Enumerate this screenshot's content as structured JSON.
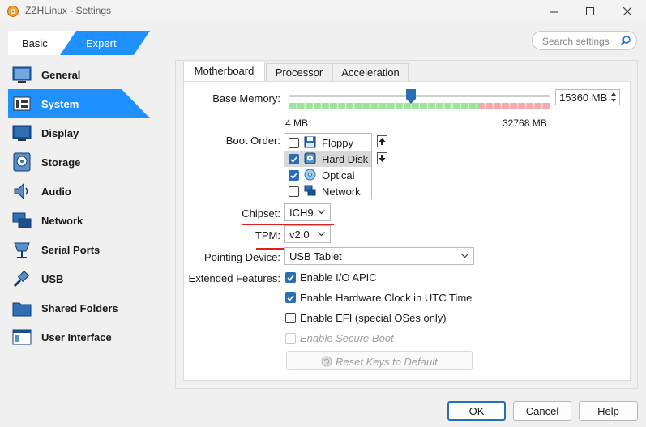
{
  "window": {
    "title": "ZZHLinux - Settings"
  },
  "mode_tabs": {
    "basic": "Basic",
    "expert": "Expert"
  },
  "search": {
    "placeholder": "Search settings"
  },
  "sidebar": {
    "items": [
      {
        "label": "General",
        "icon": "general-icon"
      },
      {
        "label": "System",
        "icon": "system-icon",
        "selected": true
      },
      {
        "label": "Display",
        "icon": "display-icon"
      },
      {
        "label": "Storage",
        "icon": "storage-icon"
      },
      {
        "label": "Audio",
        "icon": "audio-icon"
      },
      {
        "label": "Network",
        "icon": "network-icon"
      },
      {
        "label": "Serial Ports",
        "icon": "serial-ports-icon"
      },
      {
        "label": "USB",
        "icon": "usb-icon"
      },
      {
        "label": "Shared Folders",
        "icon": "shared-folders-icon"
      },
      {
        "label": "User Interface",
        "icon": "user-interface-icon"
      }
    ]
  },
  "tabs": {
    "motherboard": "Motherboard",
    "processor": "Processor",
    "acceleration": "Acceleration",
    "active": "Motherboard"
  },
  "motherboard": {
    "base_memory_label": "Base Memory:",
    "memory_value": "15360 MB",
    "memory_value_mb": 15360,
    "memory_min": "4 MB",
    "memory_max": "32768 MB",
    "boot_order_label": "Boot Order:",
    "boot_items": [
      {
        "label": "Floppy",
        "checked": false
      },
      {
        "label": "Hard Disk",
        "checked": true,
        "selected": true
      },
      {
        "label": "Optical",
        "checked": true
      },
      {
        "label": "Network",
        "checked": false
      }
    ],
    "chipset_label": "Chipset:",
    "chipset_value": "ICH9",
    "tpm_label": "TPM:",
    "tpm_value": "v2.0",
    "pointing_label": "Pointing Device:",
    "pointing_value": "USB Tablet",
    "extended_label": "Extended Features:",
    "features": {
      "io_apic": "Enable I/O APIC",
      "utc_clock": "Enable Hardware Clock in UTC Time",
      "efi": "Enable EFI (special OSes only)",
      "secure_boot": "Enable Secure Boot"
    },
    "reset_keys": "Reset Keys to Default"
  },
  "buttons": {
    "ok": "OK",
    "cancel": "Cancel",
    "help": "Help"
  },
  "colors": {
    "accent": "#1e90ff",
    "slider_green": "#9ee29e",
    "slider_red": "#f4aaaa",
    "annotation": "#e01e1e"
  }
}
